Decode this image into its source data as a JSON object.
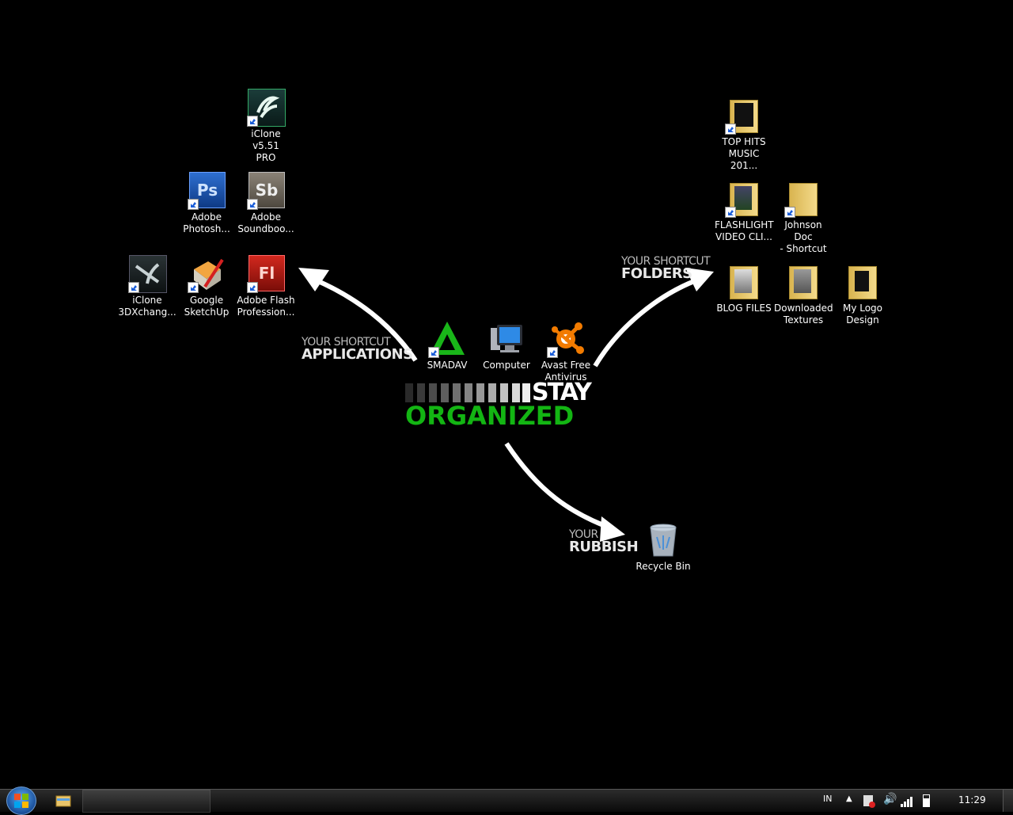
{
  "wallpaper": {
    "applications_small": "YOUR SHORTCUT",
    "applications_big": "APPLICATIONS",
    "folders_small": "YOUR SHORTCUT",
    "folders_big": "FOLDERS",
    "rubbish_small": "YOUR",
    "rubbish_big": "RUBBISH",
    "stay": "STAY",
    "organized": "ORGANIZED",
    "accent": "#13b513"
  },
  "icons": {
    "iclone": "iClone v5.51\nPRO",
    "photoshop": "Adobe\nPhotosh...",
    "soundbooth": "Adobe\nSoundboo...",
    "iclone3dx": "iClone\n3DXchang...",
    "sketchup": "Google\nSketchUp",
    "flash": "Adobe Flash\nProfession...",
    "smadav": "SMADAV",
    "computer": "Computer",
    "avast": "Avast Free\nAntivirus",
    "tophits": "TOP HITS\nMUSIC 201...",
    "flashlight": "FLASHLIGHT\nVIDEO CLI...",
    "johnson": "Johnson Doc\n- Shortcut",
    "blogfiles": "BLOG FILES",
    "textures": "Downloaded\nTextures",
    "logodesign": "My Logo\nDesign",
    "recycle": "Recycle Bin"
  },
  "taskbar": {
    "language": "IN",
    "clock": "11:29"
  }
}
